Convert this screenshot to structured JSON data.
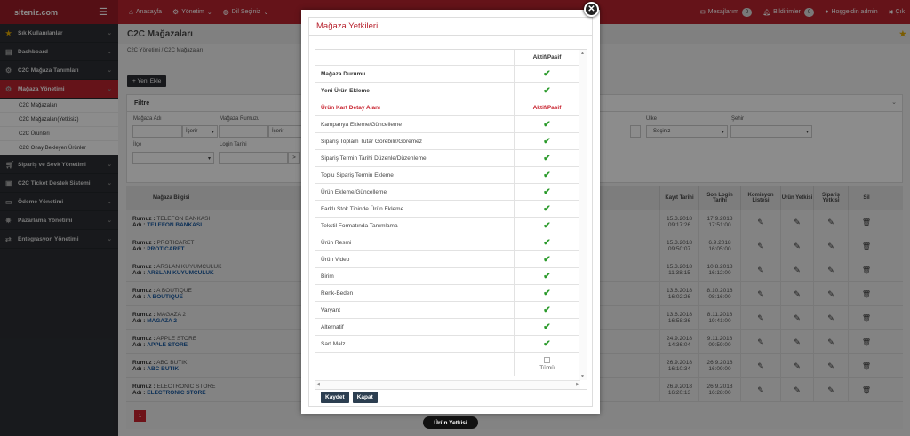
{
  "brand": "siteniz.com",
  "topnav": [
    {
      "icon": "home-icon",
      "label": "Anasayfa"
    },
    {
      "icon": "gear-icon",
      "label": "Yönetim"
    },
    {
      "icon": "globe-icon",
      "label": "Dil Seçiniz"
    }
  ],
  "topright": {
    "messages": "Mesajlarım",
    "messages_count": "0",
    "notifications": "Bildirimler",
    "notifications_count": "0",
    "welcome": "Hoşgeldin admin",
    "logout": "Çık"
  },
  "sidebar": [
    {
      "label": "Sık Kullanılanlar",
      "icon": "star-icon",
      "type": "item"
    },
    {
      "label": "Dashboard",
      "icon": "dashboard-icon",
      "type": "item"
    },
    {
      "label": "C2C Mağaza Tanımları",
      "icon": "gear-icon",
      "type": "item"
    },
    {
      "label": "Mağaza Yönetimi",
      "icon": "gear-icon",
      "type": "active"
    },
    {
      "label": "C2C Mağazaları",
      "type": "sub"
    },
    {
      "label": "C2C Mağazaları(Yetkisiz)",
      "type": "sub"
    },
    {
      "label": "C2C Ürünleri",
      "type": "sub"
    },
    {
      "label": "C2C Onay Bekleyen Ürünler",
      "type": "sub"
    },
    {
      "label": "Sipariş ve Sevk Yönetimi",
      "icon": "cart-icon",
      "type": "item"
    },
    {
      "label": "C2C Ticket Destek Sistemi",
      "icon": "ticket-icon",
      "type": "item"
    },
    {
      "label": "Ödeme Yönetimi",
      "icon": "card-icon",
      "type": "item"
    },
    {
      "label": "Pazarlama Yönetimi",
      "icon": "megaphone-icon",
      "type": "item"
    },
    {
      "label": "Entegrasyon Yönetimi",
      "icon": "exchange-icon",
      "type": "item"
    }
  ],
  "page": {
    "title": "C2C Mağazaları",
    "breadcrumb": "C2C Yönetimi / C2C Mağazaları",
    "add_button": "+ Yeni Ekle"
  },
  "filter": {
    "title": "Filtre",
    "magaza_adi": "Mağaza Adı",
    "icerir": "İçerir",
    "magaza_rumuzu": "Mağaza Rumuzu",
    "ulke": "Ülke",
    "sehir": "Şehir",
    "seciniz": "--Seçiniz--",
    "ilce": "İlçe",
    "login_tarihi": "Login Tarihi",
    "dash": "-",
    "gt": ">"
  },
  "grid": {
    "headers": {
      "bilgi": "Mağaza Bilgisi",
      "kayit": "Kayıt Tarihi",
      "son_login": "Son Login Tarihi",
      "komisyon": "Komisyon Listesi",
      "urun": "Ürün Yetkisi",
      "siparis": "Sipariş Yetkisi",
      "sil": "Sil"
    },
    "rumuz_label": "Rumuz :",
    "adi_label": "Adı :",
    "rows": [
      {
        "rumuz": "TELEFON BANKASI",
        "adi": "TELEFON BANKASI",
        "kayit_date": "15.3.2018",
        "kayit_time": "09:17:26",
        "login_date": "17.9.2018",
        "login_time": "17:51:00"
      },
      {
        "rumuz": "PROTICARET",
        "adi": "PROTICARET",
        "kayit_date": "15.3.2018",
        "kayit_time": "09:50:07",
        "login_date": "6.9.2018",
        "login_time": "16:05:00"
      },
      {
        "rumuz": "ARSLAN KUYUMCULUK",
        "adi": "ARSLAN KUYUMCULUK",
        "kayit_date": "15.3.2018",
        "kayit_time": "11:38:15",
        "login_date": "10.8.2018",
        "login_time": "16:12:00"
      },
      {
        "rumuz": "A BOUTIQUE",
        "adi": "A BOUTIQUE",
        "kayit_date": "13.6.2018",
        "kayit_time": "16:02:26",
        "login_date": "8.10.2018",
        "login_time": "08:16:00"
      },
      {
        "rumuz": "MAGAZA 2",
        "adi": "MAGAZA 2",
        "kayit_date": "13.6.2018",
        "kayit_time": "16:58:36",
        "login_date": "8.11.2018",
        "login_time": "19:41:00"
      },
      {
        "rumuz": "APPLE STORE",
        "adi": "APPLE STORE",
        "kayit_date": "24.9.2018",
        "kayit_time": "14:36:04",
        "login_date": "9.11.2018",
        "login_time": "09:59:00"
      },
      {
        "rumuz": "ABC BUTIK",
        "adi": "ABC BUTIK",
        "kayit_date": "26.9.2018",
        "kayit_time": "16:10:34",
        "login_date": "26.9.2018",
        "login_time": "16:09:00"
      },
      {
        "rumuz": "ELECTRONIC STORE",
        "adi": "ELECTRONIC STORE",
        "kayit_date": "26.9.2018",
        "kayit_time": "16:20:13",
        "login_date": "26.9.2018",
        "login_time": "16:28:00"
      }
    ],
    "page": "1"
  },
  "modal": {
    "title": "Mağaza Yetkileri",
    "col_header": "Aktif/Pasif",
    "rows": [
      {
        "label": "Mağaza Durumu",
        "style": "bold",
        "value": "check"
      },
      {
        "label": "Yeni Ürün Ekleme",
        "style": "bold",
        "value": "check"
      },
      {
        "label": "Ürün Kart Detay Alanı",
        "style": "red",
        "value": "Aktif/Pasif"
      },
      {
        "label": "Kampanya Ekleme/Güncelleme",
        "style": "",
        "value": "check"
      },
      {
        "label": "Sipariş Toplam Tutar Görebilir/Göremez",
        "style": "",
        "value": "check"
      },
      {
        "label": "Sipariş Termin Tarihi Düzenle/Düzenleme",
        "style": "",
        "value": "check"
      },
      {
        "label": "Toplu Sipariş Termin Ekleme",
        "style": "",
        "value": "check"
      },
      {
        "label": "Ürün Ekleme/Güncelleme",
        "style": "",
        "value": "check"
      },
      {
        "label": "Farklı Stok Tipinde Ürün Ekleme",
        "style": "",
        "value": "check"
      },
      {
        "label": "Tekstil Formatında Tanımlama",
        "style": "",
        "value": "check"
      },
      {
        "label": "Ürün Resmi",
        "style": "",
        "value": "check"
      },
      {
        "label": "Ürün Video",
        "style": "",
        "value": "check"
      },
      {
        "label": "Birim",
        "style": "",
        "value": "check"
      },
      {
        "label": "Renk-Beden",
        "style": "",
        "value": "check"
      },
      {
        "label": "Varyant",
        "style": "",
        "value": "check"
      },
      {
        "label": "Alternatif",
        "style": "",
        "value": "check"
      },
      {
        "label": "Sarf Malz",
        "style": "",
        "value": "check"
      }
    ],
    "tumu": "Tümü",
    "save": "Kaydet",
    "close": "Kapat"
  },
  "bottom_button": "Ürün Yetkisi"
}
